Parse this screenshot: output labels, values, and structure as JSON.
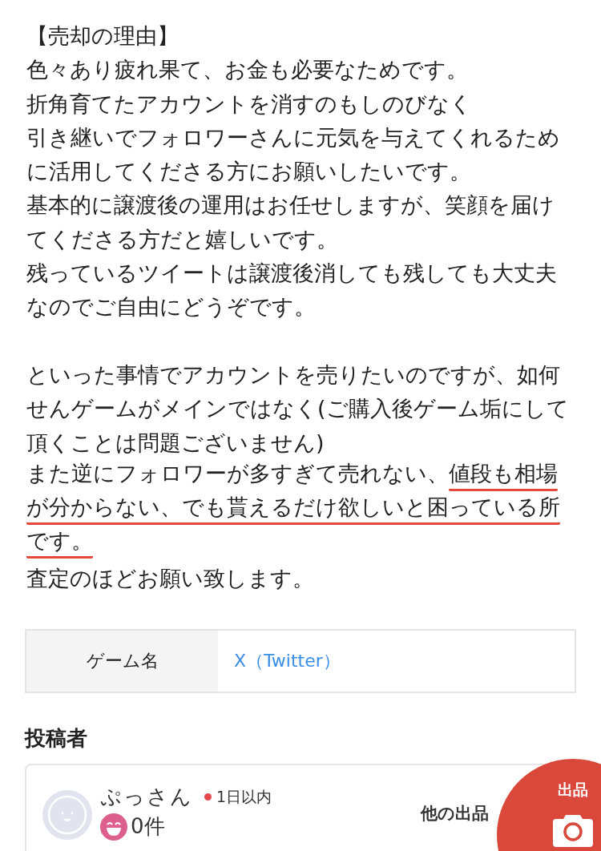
{
  "description": {
    "paragraphs": [
      [
        {
          "text": "【売却の理由】"
        },
        {
          "text": "色々あり疲れ果て、お金も必要なためです。"
        },
        {
          "text": "折角育てたアカウントを消すのもしのびなく"
        },
        {
          "text": "引き継いでフォロワーさんに元気を与えてくれるため"
        },
        {
          "text": "に活用してくださる方にお願いしたいです。"
        },
        {
          "text": "基本的に譲渡後の運用はお任せしますが、笑顔を届け"
        },
        {
          "text": "てくださる方だと嬉しいです。"
        },
        {
          "text": "残っているツイートは譲渡後消しても残しても大丈夫"
        },
        {
          "text": "なのでご自由にどうぞです。"
        }
      ],
      [
        {
          "text": "といった事情でアカウントを売りたいのですが、如何"
        },
        {
          "text": "せんゲームがメインではなく(ご購入後ゲーム垢にして"
        },
        {
          "text": "頂くことは問題ございません)"
        },
        {
          "segments": [
            {
              "text": "また逆にフォロワーが多すぎて売れない、",
              "underlined": false
            },
            {
              "text": "値段も相場",
              "underlined": true
            }
          ]
        },
        {
          "segments": [
            {
              "text": "が分からない、でも貰えるだけ欲しいと困っている所",
              "underlined": true
            }
          ]
        },
        {
          "segments": [
            {
              "text": "です。",
              "underlined": true
            }
          ]
        },
        {
          "text": "査定のほどお願い致します。"
        }
      ]
    ]
  },
  "details": [
    {
      "label": "ゲーム名",
      "value": "X（Twitter）"
    }
  ],
  "poster": {
    "heading": "投稿者",
    "name": "ぷっさん",
    "online": true,
    "last_seen": "1日以内",
    "rating_count": "0件",
    "other_listings": "他の出品"
  },
  "sell_button": {
    "label": "出品"
  }
}
